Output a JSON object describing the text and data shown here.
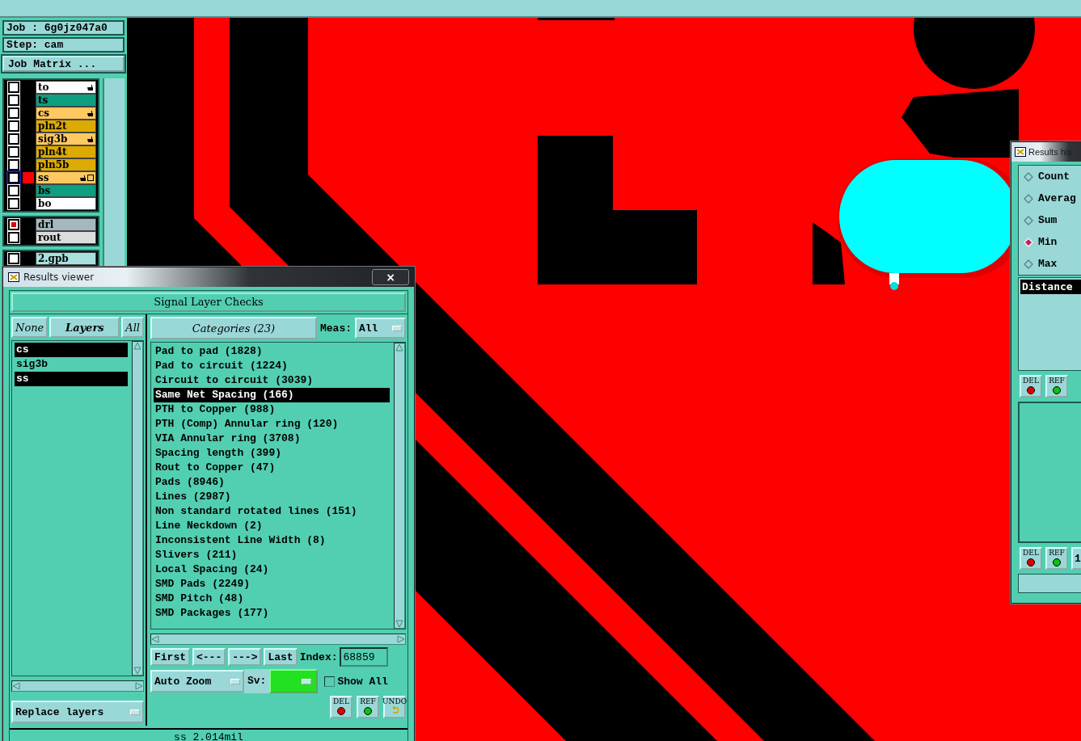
{
  "job_panel": {
    "job": "Job : 6g0jz047a0",
    "step": "Step: cam",
    "matrix_button": "Job Matrix ..."
  },
  "layer_groups": [
    {
      "layers": [
        {
          "name": "to",
          "color": "#ffffff",
          "hand": true,
          "extra": false,
          "active": false,
          "checked": false
        },
        {
          "name": "ts",
          "color": "#0e9e80",
          "hand": false,
          "extra": false,
          "active": false,
          "checked": false
        },
        {
          "name": "cs",
          "color": "#ffc860",
          "hand": true,
          "extra": false,
          "active": false,
          "checked": false
        },
        {
          "name": "pln2t",
          "color": "#dcaa00",
          "hand": false,
          "extra": false,
          "active": false,
          "checked": false
        },
        {
          "name": "sig3b",
          "color": "#ffc860",
          "hand": true,
          "extra": false,
          "active": false,
          "checked": false
        },
        {
          "name": "pln4t",
          "color": "#dcaa00",
          "hand": false,
          "extra": false,
          "active": false,
          "checked": false
        },
        {
          "name": "pln5b",
          "color": "#dcaa00",
          "hand": false,
          "extra": false,
          "active": false,
          "checked": false
        },
        {
          "name": "ss",
          "color": "#ffc860",
          "hand": true,
          "extra": true,
          "active": true,
          "checked": false
        },
        {
          "name": "bs",
          "color": "#0e9e80",
          "hand": false,
          "extra": false,
          "active": false,
          "checked": false
        },
        {
          "name": "bo",
          "color": "#ffffff",
          "hand": false,
          "extra": false,
          "active": false,
          "checked": false
        }
      ]
    },
    {
      "layers": [
        {
          "name": "drl",
          "color": "#a4b8c0",
          "hand": false,
          "extra": false,
          "active": false,
          "checked": true
        },
        {
          "name": "rout",
          "color": "#dcdcdc",
          "hand": false,
          "extra": false,
          "active": false,
          "checked": false
        }
      ]
    },
    {
      "layers": [
        {
          "name": "2.gpb",
          "color": "#a8e0e0",
          "hand": false,
          "extra": false,
          "active": false,
          "checked": false
        }
      ]
    }
  ],
  "results_viewer": {
    "title": "Results viewer",
    "close": "×",
    "heading": "Signal Layer Checks",
    "layer_buttons": [
      {
        "label": "None",
        "kind": "toggle"
      },
      {
        "label": "Layers",
        "kind": "header"
      },
      {
        "label": "All",
        "kind": "toggle"
      }
    ],
    "layers": [
      {
        "name": "cs",
        "selected": true
      },
      {
        "name": "sig3b",
        "selected": false
      },
      {
        "name": "ss",
        "selected": true
      }
    ],
    "replace": "Replace layers",
    "categories_button": "Categories (23)",
    "meas_label": "Meas:",
    "meas_value": "All",
    "categories": [
      {
        "label": "Pad to pad (1828)",
        "selected": false
      },
      {
        "label": "Pad to circuit (1224)",
        "selected": false
      },
      {
        "label": "Circuit to circuit (3039)",
        "selected": false
      },
      {
        "label": "Same Net Spacing (166)",
        "selected": true
      },
      {
        "label": "PTH to Copper (988)",
        "selected": false
      },
      {
        "label": "PTH (Comp) Annular ring (120)",
        "selected": false
      },
      {
        "label": "VIA Annular ring (3708)",
        "selected": false
      },
      {
        "label": "Spacing length (399)",
        "selected": false
      },
      {
        "label": "Rout to Copper (47)",
        "selected": false
      },
      {
        "label": "Pads (8946)",
        "selected": false
      },
      {
        "label": "Lines (2987)",
        "selected": false
      },
      {
        "label": "Non standard rotated lines (151)",
        "selected": false
      },
      {
        "label": "Line Neckdown (2)",
        "selected": false
      },
      {
        "label": "Inconsistent Line Width (8)",
        "selected": false
      },
      {
        "label": "Slivers (211)",
        "selected": false
      },
      {
        "label": "Local Spacing (24)",
        "selected": false
      },
      {
        "label": "SMD Pads (2249)",
        "selected": false
      },
      {
        "label": "SMD Pitch (48)",
        "selected": false
      },
      {
        "label": "SMD Packages (177)",
        "selected": false
      }
    ],
    "nav": [
      "First",
      "<---",
      "--->",
      "Last"
    ],
    "index_label": "Index:",
    "index_value": "68859",
    "zoom": "Auto Zoom",
    "sv_label": "Sv:",
    "show_all": {
      "label": "Show All",
      "checked": false
    },
    "actions": [
      {
        "label": "DEL",
        "kind": "del"
      },
      {
        "label": "REF",
        "kind": "ref"
      },
      {
        "label": "UNDO",
        "kind": "undo"
      }
    ],
    "status": "ss 2.014mil"
  },
  "histogram": {
    "title": "Results his",
    "stats": [
      {
        "label": "Count",
        "selected": false
      },
      {
        "label": "Averag",
        "selected": false
      },
      {
        "label": "Sum",
        "selected": false
      },
      {
        "label": "Min",
        "selected": true
      },
      {
        "label": "Max",
        "selected": false
      }
    ],
    "list": [
      "Distance"
    ],
    "actions": [
      {
        "label": "DEL",
        "kind": "del"
      },
      {
        "label": "REF",
        "kind": "ref"
      }
    ],
    "actions2": [
      {
        "label": "DEL",
        "kind": "del"
      },
      {
        "label": "REF",
        "kind": "ref"
      },
      {
        "label": "1",
        "kind": "plain"
      }
    ]
  }
}
